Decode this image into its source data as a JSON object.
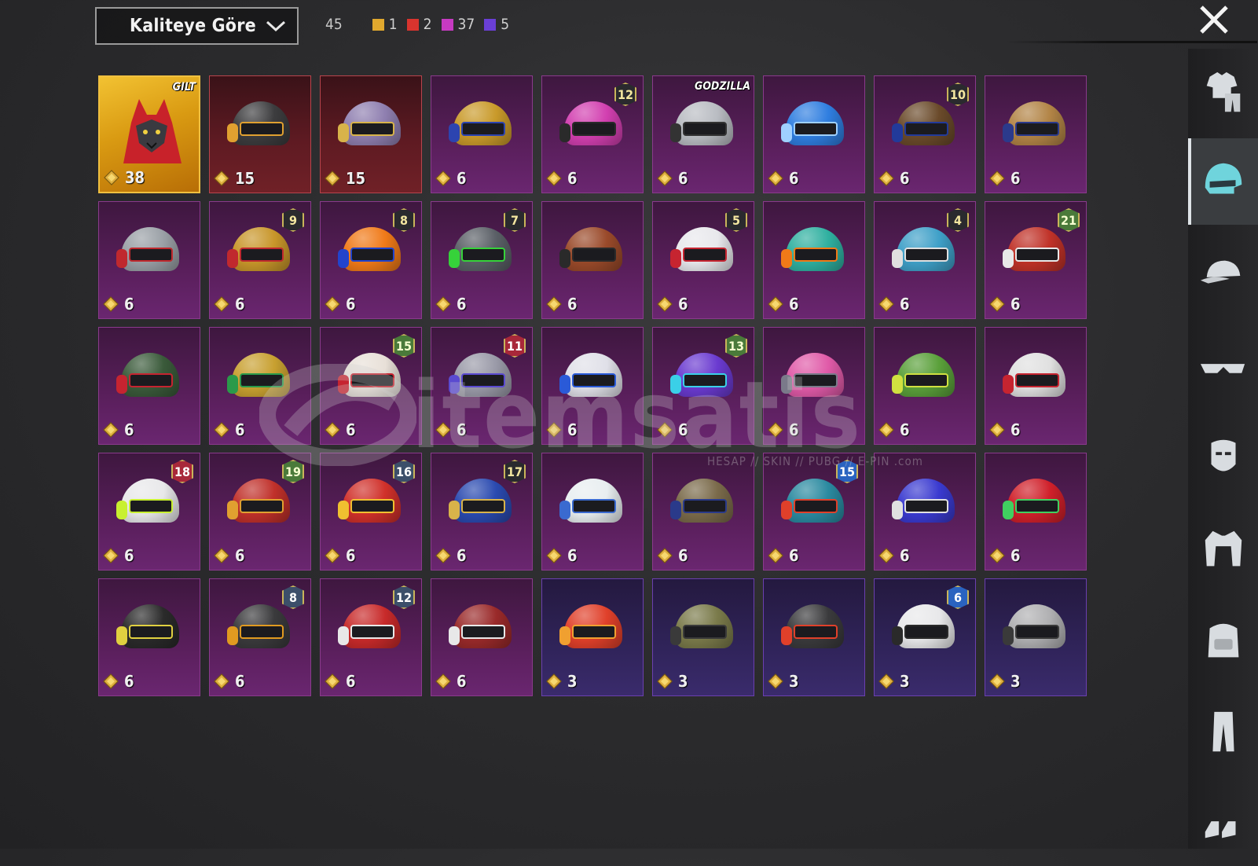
{
  "sort": {
    "label": "Kaliteye Göre"
  },
  "counts": {
    "total": "45",
    "by_quality": [
      {
        "name": "legendary",
        "color": "#e0a82e",
        "value": "1"
      },
      {
        "name": "mythic-red",
        "color": "#d9342e",
        "value": "2"
      },
      {
        "name": "epic",
        "color": "#c73ac2",
        "value": "37"
      },
      {
        "name": "rare",
        "color": "#6a3fd6",
        "value": "5"
      }
    ]
  },
  "items": [
    {
      "quality": "legend",
      "price": "38",
      "brand": "GILT",
      "helmet": "wolf"
    },
    {
      "quality": "red",
      "price": "15",
      "helmet": "#3c3c3e",
      "accent": "#e0a030"
    },
    {
      "quality": "red",
      "price": "15",
      "helmet": "#8f7fb0",
      "accent": "#d8b34a"
    },
    {
      "quality": "epic",
      "price": "6",
      "helmet": "#c99a2a",
      "accent": "#2c44b0"
    },
    {
      "quality": "epic",
      "price": "6",
      "helmet": "#d23fb0",
      "accent": "#2a2a2a",
      "level": "12",
      "badge": ""
    },
    {
      "quality": "epic",
      "price": "6",
      "helmet": "#b9bcc2",
      "accent": "#333",
      "brand": "GODZILLA"
    },
    {
      "quality": "epic",
      "price": "6",
      "helmet": "#2f7ee0",
      "accent": "#9fd0ff"
    },
    {
      "quality": "epic",
      "price": "6",
      "helmet": "#6a4a2a",
      "accent": "#223a9a",
      "level": "10",
      "badge": ""
    },
    {
      "quality": "epic",
      "price": "6",
      "helmet": "#b28446",
      "accent": "#2b3a8c"
    },
    {
      "quality": "epic",
      "price": "6",
      "helmet": "#9aa0a6",
      "accent": "#c0292e"
    },
    {
      "quality": "epic",
      "price": "6",
      "helmet": "#c8962a",
      "accent": "#c0292e",
      "level": "9",
      "badge": ""
    },
    {
      "quality": "epic",
      "price": "6",
      "helmet": "#f07a18",
      "accent": "#2244cc",
      "level": "8",
      "badge": ""
    },
    {
      "quality": "epic",
      "price": "6",
      "helmet": "#5a5f66",
      "accent": "#36d23a",
      "level": "7",
      "badge": ""
    },
    {
      "quality": "epic",
      "price": "6",
      "helmet": "#9a4a2a",
      "accent": "#2a2a2a"
    },
    {
      "quality": "epic",
      "price": "6",
      "helmet": "#e8e8ec",
      "accent": "#c62430",
      "level": "5",
      "badge": ""
    },
    {
      "quality": "epic",
      "price": "6",
      "helmet": "#2fb0a0",
      "accent": "#f07a18"
    },
    {
      "quality": "epic",
      "price": "6",
      "helmet": "#3fa0c8",
      "accent": "#e0e0e0",
      "level": "4",
      "badge": ""
    },
    {
      "quality": "epic",
      "price": "6",
      "helmet": "#c03228",
      "accent": "#e8e8e8",
      "level": "21",
      "badge": "green"
    },
    {
      "quality": "epic",
      "price": "6",
      "helmet": "#3a5a3a",
      "accent": "#c62430"
    },
    {
      "quality": "epic",
      "price": "6",
      "helmet": "#c8a030",
      "accent": "#2a9a4a"
    },
    {
      "quality": "epic",
      "price": "6",
      "helmet": "#e8e0d8",
      "accent": "#c62430",
      "level": "15",
      "badge": "green"
    },
    {
      "quality": "epic",
      "price": "6",
      "helmet": "#9a9aa8",
      "accent": "#5a4ad0",
      "level": "11",
      "badge": "red"
    },
    {
      "quality": "epic",
      "price": "6",
      "helmet": "#e0e0e8",
      "accent": "#2a5ad8"
    },
    {
      "quality": "epic",
      "price": "6",
      "helmet": "#6a3ad0",
      "accent": "#3ad0e8",
      "level": "13",
      "badge": "green"
    },
    {
      "quality": "epic",
      "price": "6",
      "helmet": "#e05aa8",
      "accent": "#7a7a8a"
    },
    {
      "quality": "epic",
      "price": "6",
      "helmet": "#5aa03a",
      "accent": "#d0e040"
    },
    {
      "quality": "epic",
      "price": "6",
      "helmet": "#e0e0e0",
      "accent": "#c62430"
    },
    {
      "quality": "epic",
      "price": "6",
      "helmet": "#e8e8ea",
      "accent": "#c8f030",
      "level": "18",
      "badge": "red"
    },
    {
      "quality": "epic",
      "price": "6",
      "helmet": "#c0302a",
      "accent": "#e0a030",
      "level": "19",
      "badge": "green"
    },
    {
      "quality": "epic",
      "price": "6",
      "helmet": "#d0302a",
      "accent": "#f0c030",
      "level": "16",
      "badge": "steel"
    },
    {
      "quality": "epic",
      "price": "6",
      "helmet": "#2a4ab0",
      "accent": "#d8b34a",
      "level": "17",
      "badge": ""
    },
    {
      "quality": "epic",
      "price": "6",
      "helmet": "#e8eef0",
      "accent": "#3a6ad0"
    },
    {
      "quality": "epic",
      "price": "6",
      "helmet": "#7a6a4a",
      "accent": "#2a3a8a"
    },
    {
      "quality": "epic",
      "price": "6",
      "helmet": "#2a8aa0",
      "accent": "#e0402a",
      "level": "15",
      "badge": "blue"
    },
    {
      "quality": "epic",
      "price": "6",
      "helmet": "#3a3ad0",
      "accent": "#e0e0e0"
    },
    {
      "quality": "epic",
      "price": "6",
      "helmet": "#d0202a",
      "accent": "#40d060"
    },
    {
      "quality": "epic",
      "price": "6",
      "helmet": "#2a2a2a",
      "accent": "#e0d040"
    },
    {
      "quality": "epic",
      "price": "6",
      "helmet": "#3a3a3c",
      "accent": "#e09a20",
      "level": "8",
      "badge": "steel"
    },
    {
      "quality": "epic",
      "price": "6",
      "helmet": "#c82a2a",
      "accent": "#e8e8e8",
      "level": "12",
      "badge": "steel"
    },
    {
      "quality": "epic",
      "price": "6",
      "helmet": "#9a2a2a",
      "accent": "#e8e8e8"
    },
    {
      "quality": "rare",
      "price": "3",
      "helmet": "#e0402a",
      "accent": "#f0a030"
    },
    {
      "quality": "rare",
      "price": "3",
      "helmet": "#7a7a4a",
      "accent": "#3a3a3a"
    },
    {
      "quality": "rare",
      "price": "3",
      "helmet": "#3a3a3c",
      "accent": "#e0402a"
    },
    {
      "quality": "rare",
      "price": "3",
      "helmet": "#e8e8ea",
      "accent": "#2a2a2a",
      "level": "6",
      "badge": "blue"
    },
    {
      "quality": "rare",
      "price": "3",
      "helmet": "#b0b0b2",
      "accent": "#3a3a3a"
    }
  ],
  "watermark": {
    "text": "itemsatis",
    "sub": "HESAP // SKIN // PUBG // E-PIN  .com"
  },
  "rail": [
    {
      "name": "outfit-icon"
    },
    {
      "name": "helmet-icon",
      "active": true
    },
    {
      "name": "cap-icon"
    },
    {
      "name": "glasses-icon"
    },
    {
      "name": "mask-icon"
    },
    {
      "name": "jacket-icon"
    },
    {
      "name": "backpack-icon"
    },
    {
      "name": "pants-icon"
    },
    {
      "name": "shoes-icon"
    }
  ]
}
